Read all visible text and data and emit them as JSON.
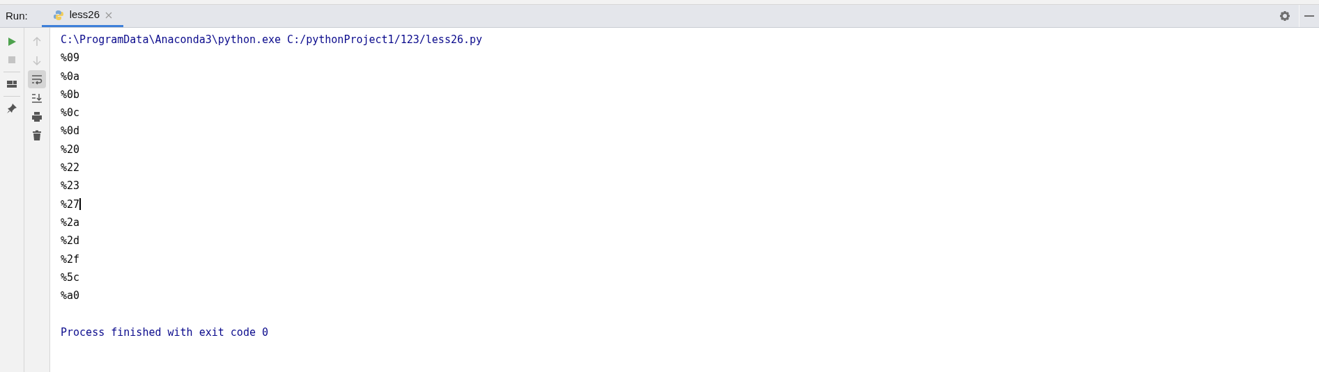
{
  "run_panel": {
    "label": "Run:",
    "tabs": [
      {
        "label": "less26",
        "selected": true,
        "closable": true
      }
    ]
  },
  "left_toolbar": [
    {
      "kind": "run",
      "disabled": false
    },
    {
      "kind": "stop",
      "disabled": true
    },
    {
      "kind": "layout",
      "disabled": false
    },
    {
      "kind": "pin",
      "disabled": false
    }
  ],
  "console_toolbar": [
    {
      "kind": "up",
      "disabled": true,
      "selected": false
    },
    {
      "kind": "down",
      "disabled": true,
      "selected": false
    },
    {
      "kind": "wrap",
      "disabled": false,
      "selected": true
    },
    {
      "kind": "scroll_end",
      "disabled": false,
      "selected": false
    },
    {
      "kind": "print",
      "disabled": false,
      "selected": false
    },
    {
      "kind": "trash",
      "disabled": false,
      "selected": false
    }
  ],
  "console": [
    {
      "kind": "command",
      "text": "C:\\ProgramData\\Anaconda3\\python.exe C:/pythonProject1/123/less26.py",
      "caret": false
    },
    {
      "kind": "output",
      "text": "%09",
      "caret": false
    },
    {
      "kind": "output",
      "text": "%0a",
      "caret": false
    },
    {
      "kind": "output",
      "text": "%0b",
      "caret": false
    },
    {
      "kind": "output",
      "text": "%0c",
      "caret": false
    },
    {
      "kind": "output",
      "text": "%0d",
      "caret": false
    },
    {
      "kind": "output",
      "text": "%20",
      "caret": false
    },
    {
      "kind": "output",
      "text": "%22",
      "caret": false
    },
    {
      "kind": "output",
      "text": "%23",
      "caret": false
    },
    {
      "kind": "output",
      "text": "%27",
      "caret": true
    },
    {
      "kind": "output",
      "text": "%2a",
      "caret": false
    },
    {
      "kind": "output",
      "text": "%2d",
      "caret": false
    },
    {
      "kind": "output",
      "text": "%2f",
      "caret": false
    },
    {
      "kind": "output",
      "text": "%5c",
      "caret": false
    },
    {
      "kind": "output",
      "text": "%a0",
      "caret": false
    },
    {
      "kind": "blank"
    },
    {
      "kind": "system",
      "text": "Process finished with exit code 0",
      "caret": false
    }
  ]
}
